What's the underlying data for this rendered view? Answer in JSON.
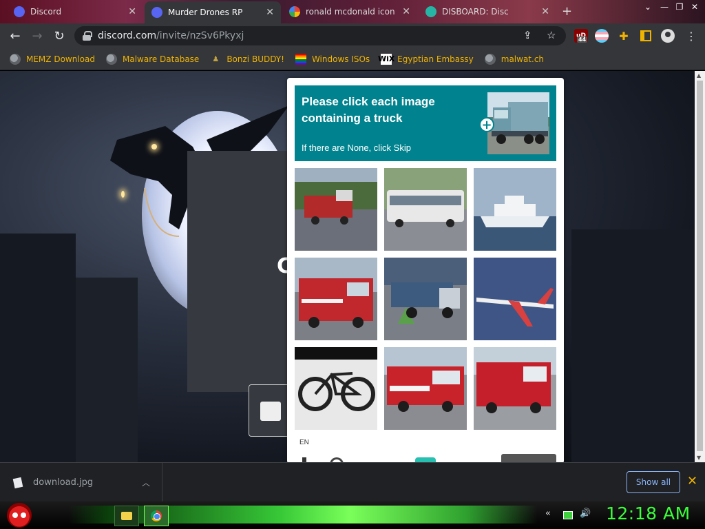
{
  "browser": {
    "tabs": [
      {
        "title": "Discord",
        "favicon": "discord-icon",
        "active": false
      },
      {
        "title": "Murder Drones RP",
        "favicon": "discord-icon",
        "active": true
      },
      {
        "title": "ronald mcdonald icon",
        "favicon": "google-icon",
        "active": false
      },
      {
        "title": "DISBOARD: Disc",
        "favicon": "disboard-icon",
        "active": false
      }
    ],
    "new_tab_label": "+",
    "url_domain": "discord.com",
    "url_path": "/invite/nzSv6Pkyxj",
    "extension_badge": "44",
    "bookmarks": [
      {
        "label": "MEMZ Download",
        "icon": "globe-icon"
      },
      {
        "label": "Malware Database",
        "icon": "globe-icon"
      },
      {
        "label": "Bonzi BUDDY!",
        "icon": "bonzi-icon"
      },
      {
        "label": "Windows ISOs",
        "icon": "rainbow-flag-icon"
      },
      {
        "label": "Egyptian Embassy",
        "icon": "wix-icon"
      },
      {
        "label": "malwat.ch",
        "icon": "globe-icon"
      }
    ],
    "wix_label": "WiX"
  },
  "page": {
    "card_letter": "C"
  },
  "captcha": {
    "title": "Please click each image containing a truck",
    "hint": "If there are None, click Skip",
    "language": "EN",
    "tiles": [
      {
        "subject": "fire truck"
      },
      {
        "subject": "bus"
      },
      {
        "subject": "ship"
      },
      {
        "subject": "fire truck"
      },
      {
        "subject": "truck"
      },
      {
        "subject": "airplane"
      },
      {
        "subject": "bicycle"
      },
      {
        "subject": "fire truck"
      },
      {
        "subject": "fire truck"
      }
    ],
    "accent_color": "#00838f"
  },
  "downloads": {
    "file_name": "download.jpg",
    "show_all_label": "Show all"
  },
  "taskbar": {
    "clock": "12:18 AM"
  }
}
